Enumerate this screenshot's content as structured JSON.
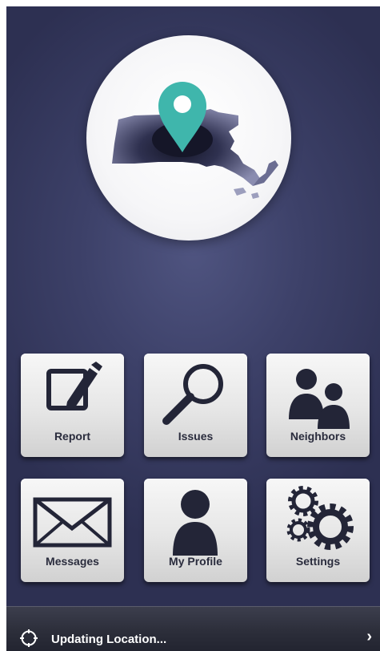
{
  "menu": {
    "report_label": "Report",
    "issues_label": "Issues",
    "neighbors_label": "Neighbors",
    "messages_label": "Messages",
    "profile_label": "My Profile",
    "settings_label": "Settings"
  },
  "status_bar": {
    "text": "Updating Location...",
    "chevron": "›",
    "icon": "crosshair-icon"
  },
  "colors": {
    "background": "#3d4169",
    "pin": "#3fb6ac",
    "map_dark": "#2a2c45",
    "tile": "#e6e6e6",
    "icon": "#232537"
  }
}
